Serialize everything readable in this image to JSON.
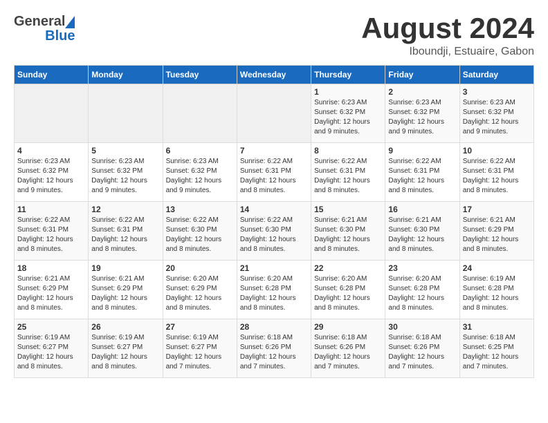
{
  "header": {
    "logo_general": "General",
    "logo_blue": "Blue",
    "main_title": "August 2024",
    "subtitle": "Iboundji, Estuaire, Gabon"
  },
  "calendar": {
    "days_of_week": [
      "Sunday",
      "Monday",
      "Tuesday",
      "Wednesday",
      "Thursday",
      "Friday",
      "Saturday"
    ],
    "weeks": [
      [
        {
          "day": "",
          "info": ""
        },
        {
          "day": "",
          "info": ""
        },
        {
          "day": "",
          "info": ""
        },
        {
          "day": "",
          "info": ""
        },
        {
          "day": "1",
          "info": "Sunrise: 6:23 AM\nSunset: 6:32 PM\nDaylight: 12 hours\nand 9 minutes."
        },
        {
          "day": "2",
          "info": "Sunrise: 6:23 AM\nSunset: 6:32 PM\nDaylight: 12 hours\nand 9 minutes."
        },
        {
          "day": "3",
          "info": "Sunrise: 6:23 AM\nSunset: 6:32 PM\nDaylight: 12 hours\nand 9 minutes."
        }
      ],
      [
        {
          "day": "4",
          "info": "Sunrise: 6:23 AM\nSunset: 6:32 PM\nDaylight: 12 hours\nand 9 minutes."
        },
        {
          "day": "5",
          "info": "Sunrise: 6:23 AM\nSunset: 6:32 PM\nDaylight: 12 hours\nand 9 minutes."
        },
        {
          "day": "6",
          "info": "Sunrise: 6:23 AM\nSunset: 6:32 PM\nDaylight: 12 hours\nand 9 minutes."
        },
        {
          "day": "7",
          "info": "Sunrise: 6:22 AM\nSunset: 6:31 PM\nDaylight: 12 hours\nand 8 minutes."
        },
        {
          "day": "8",
          "info": "Sunrise: 6:22 AM\nSunset: 6:31 PM\nDaylight: 12 hours\nand 8 minutes."
        },
        {
          "day": "9",
          "info": "Sunrise: 6:22 AM\nSunset: 6:31 PM\nDaylight: 12 hours\nand 8 minutes."
        },
        {
          "day": "10",
          "info": "Sunrise: 6:22 AM\nSunset: 6:31 PM\nDaylight: 12 hours\nand 8 minutes."
        }
      ],
      [
        {
          "day": "11",
          "info": "Sunrise: 6:22 AM\nSunset: 6:31 PM\nDaylight: 12 hours\nand 8 minutes."
        },
        {
          "day": "12",
          "info": "Sunrise: 6:22 AM\nSunset: 6:31 PM\nDaylight: 12 hours\nand 8 minutes."
        },
        {
          "day": "13",
          "info": "Sunrise: 6:22 AM\nSunset: 6:30 PM\nDaylight: 12 hours\nand 8 minutes."
        },
        {
          "day": "14",
          "info": "Sunrise: 6:22 AM\nSunset: 6:30 PM\nDaylight: 12 hours\nand 8 minutes."
        },
        {
          "day": "15",
          "info": "Sunrise: 6:21 AM\nSunset: 6:30 PM\nDaylight: 12 hours\nand 8 minutes."
        },
        {
          "day": "16",
          "info": "Sunrise: 6:21 AM\nSunset: 6:30 PM\nDaylight: 12 hours\nand 8 minutes."
        },
        {
          "day": "17",
          "info": "Sunrise: 6:21 AM\nSunset: 6:29 PM\nDaylight: 12 hours\nand 8 minutes."
        }
      ],
      [
        {
          "day": "18",
          "info": "Sunrise: 6:21 AM\nSunset: 6:29 PM\nDaylight: 12 hours\nand 8 minutes."
        },
        {
          "day": "19",
          "info": "Sunrise: 6:21 AM\nSunset: 6:29 PM\nDaylight: 12 hours\nand 8 minutes."
        },
        {
          "day": "20",
          "info": "Sunrise: 6:20 AM\nSunset: 6:29 PM\nDaylight: 12 hours\nand 8 minutes."
        },
        {
          "day": "21",
          "info": "Sunrise: 6:20 AM\nSunset: 6:28 PM\nDaylight: 12 hours\nand 8 minutes."
        },
        {
          "day": "22",
          "info": "Sunrise: 6:20 AM\nSunset: 6:28 PM\nDaylight: 12 hours\nand 8 minutes."
        },
        {
          "day": "23",
          "info": "Sunrise: 6:20 AM\nSunset: 6:28 PM\nDaylight: 12 hours\nand 8 minutes."
        },
        {
          "day": "24",
          "info": "Sunrise: 6:19 AM\nSunset: 6:28 PM\nDaylight: 12 hours\nand 8 minutes."
        }
      ],
      [
        {
          "day": "25",
          "info": "Sunrise: 6:19 AM\nSunset: 6:27 PM\nDaylight: 12 hours\nand 8 minutes."
        },
        {
          "day": "26",
          "info": "Sunrise: 6:19 AM\nSunset: 6:27 PM\nDaylight: 12 hours\nand 8 minutes."
        },
        {
          "day": "27",
          "info": "Sunrise: 6:19 AM\nSunset: 6:27 PM\nDaylight: 12 hours\nand 7 minutes."
        },
        {
          "day": "28",
          "info": "Sunrise: 6:18 AM\nSunset: 6:26 PM\nDaylight: 12 hours\nand 7 minutes."
        },
        {
          "day": "29",
          "info": "Sunrise: 6:18 AM\nSunset: 6:26 PM\nDaylight: 12 hours\nand 7 minutes."
        },
        {
          "day": "30",
          "info": "Sunrise: 6:18 AM\nSunset: 6:26 PM\nDaylight: 12 hours\nand 7 minutes."
        },
        {
          "day": "31",
          "info": "Sunrise: 6:18 AM\nSunset: 6:25 PM\nDaylight: 12 hours\nand 7 minutes."
        }
      ]
    ]
  }
}
